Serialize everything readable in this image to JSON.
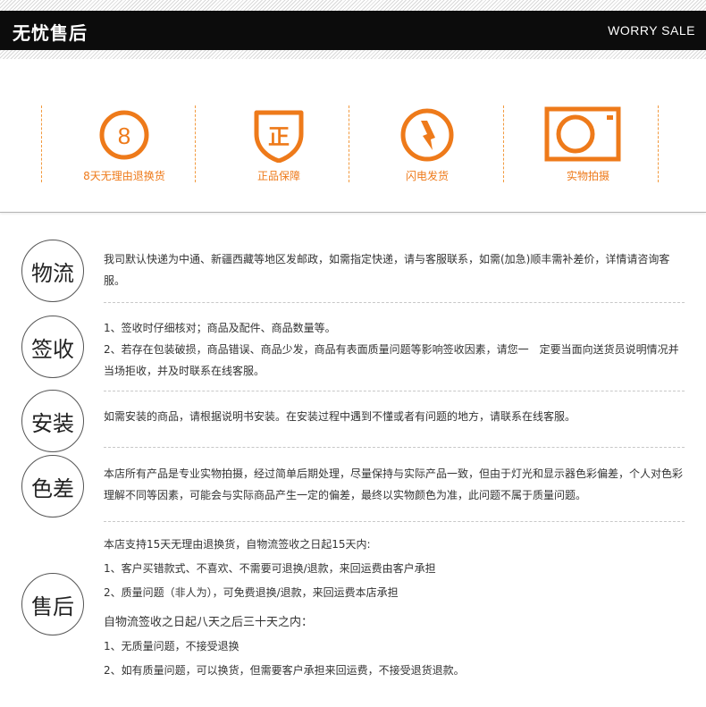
{
  "header": {
    "title": "无忧售后",
    "subtitle": "WORRY SALE"
  },
  "accent_color": "#ee7a1a",
  "features": [
    {
      "icon": "eight-days-icon",
      "icon_text": "8",
      "label": "8天无理由退换货"
    },
    {
      "icon": "genuine-shield-icon",
      "icon_text": "正",
      "label": "正品保障"
    },
    {
      "icon": "lightning-icon",
      "label": "闪电发货"
    },
    {
      "icon": "camera-icon",
      "label": "实物拍摄"
    }
  ],
  "sections": [
    {
      "title": "物流",
      "lines": [
        "我司默认快递为中通、新疆西藏等地区发邮政，如需指定快递，请与客服联系，如需(加急)顺丰需补差价，详情请咨询客服。"
      ]
    },
    {
      "title": "签收",
      "lines": [
        "1、签收时仔细核对；商品及配件、商品数量等。",
        "2、若存在包装破损，商品错误、商品少发，商品有表面质量问题等影响签收因素，请您一　定要当面向送货员说明情况并当场拒收，并及时联系在线客服。"
      ]
    },
    {
      "title": "安装",
      "lines": [
        "如需安装的商品，请根据说明书安装。在安装过程中遇到不懂或者有问题的地方，请联系在线客服。"
      ]
    },
    {
      "title": "色差",
      "lines": [
        "本店所有产品是专业实物拍摄，经过简单后期处理，尽量保持与实际产品一致，但由于灯光和显示器色彩偏差，个人对色彩理解不同等因素，可能会与实际商品产生一定的偏差，最终以实物颜色为准，此问题不属于质量问题。"
      ]
    },
    {
      "title": "售后",
      "lines": [
        "本店支持15天无理由退换货，自物流签收之日起15天内:",
        "1、客户买错款式、不喜欢、不需要可退换/退款，来回运费由客户承担",
        "2、质量问题（非人为），可免费退换/退款，来回运费本店承担",
        "自物流签收之日起八天之后三十天之内：",
        "1、无质量问题，不接受退换",
        "2、如有质量问题，可以换货，但需要客户承担来回运费，不接受退货退款。"
      ]
    }
  ]
}
